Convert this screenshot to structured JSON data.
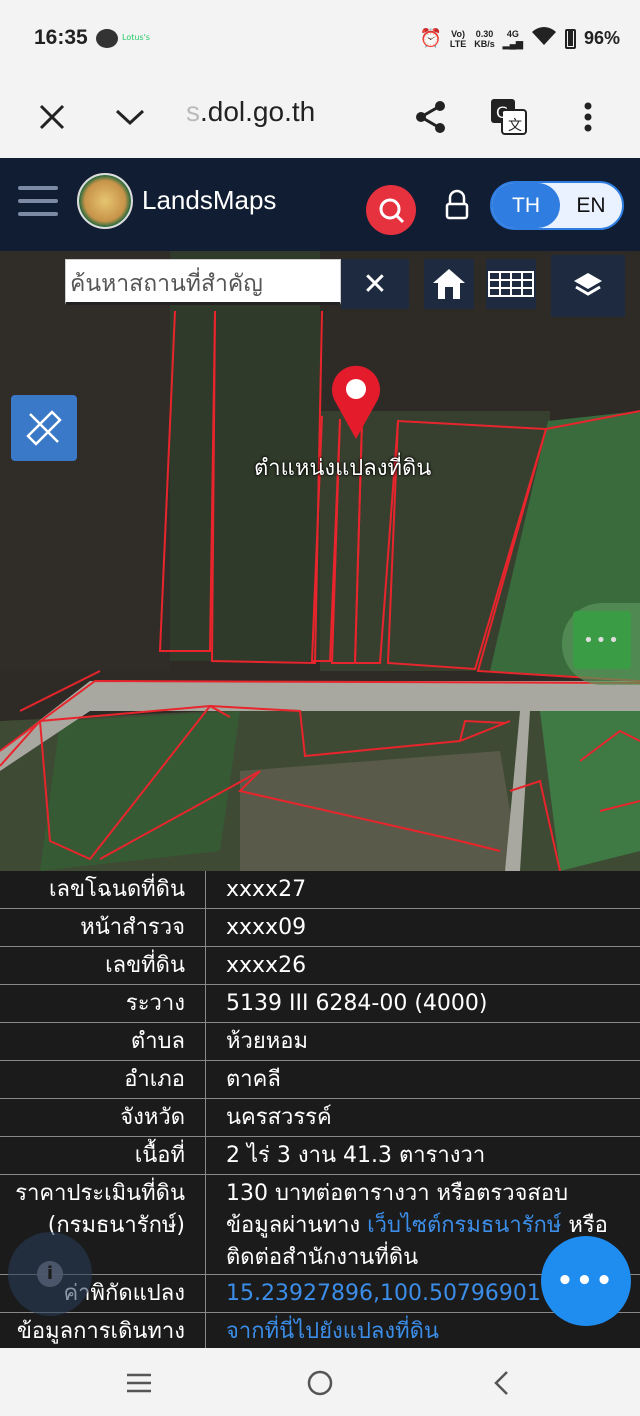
{
  "status_bar": {
    "time": "16:35",
    "notif_text": "Lotus's",
    "net_label_top": "Vo)",
    "net_label_bottom": "LTE",
    "speed_top": "0.30",
    "speed_bottom": "KB/s",
    "signal": "4G",
    "battery": "96%"
  },
  "browser": {
    "url_faded": "s",
    "url": ".dol.go.th",
    "icons": [
      "close-icon",
      "chevron-down-icon",
      "share-icon",
      "translate-icon",
      "more-vert-icon"
    ]
  },
  "app": {
    "brand": "LandsMaps",
    "lang_th": "TH",
    "lang_en": "EN"
  },
  "map": {
    "search_placeholder": "ค้นหาสถานที่สำคัญ",
    "pin_label": "ตำแหน่งแปลงที่ดิน",
    "more_dots": "•••"
  },
  "details": [
    {
      "key": "เลขโฉนดที่ดิน",
      "value": "xxxx27"
    },
    {
      "key": "หน้าสำรวจ",
      "value": "xxxx09"
    },
    {
      "key": "เลขที่ดิน",
      "value": "xxxx26"
    },
    {
      "key": "ระวาง",
      "value": "5139 III 6284-00 (4000)"
    },
    {
      "key": "ตำบล",
      "value": "ห้วยหอม"
    },
    {
      "key": "อำเภอ",
      "value": "ตาคลี"
    },
    {
      "key": "จังหวัด",
      "value": "นครสวรรค์"
    },
    {
      "key": "เนื้อที่",
      "value": "2 ไร่ 3 งาน 41.3 ตารางวา"
    }
  ],
  "price": {
    "key_line1": "ราคาประเมินที่ดิน",
    "key_line2": "(กรมธนารักษ์)",
    "v1": "130 บาทต่อตารางวา หรือตรวจสอบ",
    "v2a": "ข้อมูลผ่านทาง ",
    "v2link": "เว็บไซต์กรมธนารักษ์",
    "v2b": " หรือ",
    "v3": "ติดต่อสำนักงานที่ดิน"
  },
  "coords": {
    "key": "ค่าพิกัดแปลง",
    "value": "15.23927896,100.50796901"
  },
  "travel": {
    "key": "ข้อมูลการเดินทาง",
    "value": "จากที่นี่ไปยังแปลงที่ดิน"
  },
  "fab_dots": "•••",
  "info_glyph": "i"
}
